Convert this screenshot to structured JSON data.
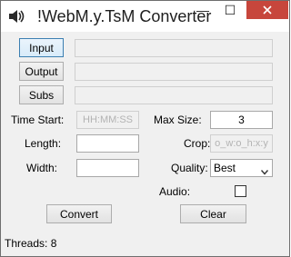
{
  "window": {
    "title": "!WebM.y.TsM Converter",
    "minimize_glyph": "—",
    "maximize_glyph": "☐",
    "close_color": "#c7463c"
  },
  "inputs": {
    "input_label": "Input",
    "output_label": "Output",
    "subs_label": "Subs",
    "input_value": "",
    "output_value": "",
    "subs_value": ""
  },
  "options": {
    "time_start_label": "Time Start:",
    "time_start_placeholder": "HH:MM:SS",
    "length_label": "Length:",
    "length_value": "",
    "width_label": "Width:",
    "width_value": "",
    "max_size_label": "Max Size:",
    "max_size_value": "3",
    "crop_label": "Crop:",
    "crop_placeholder": "o_w:o_h:x:y",
    "quality_label": "Quality:",
    "quality_value": "Best",
    "audio_label": "Audio:",
    "audio_checked": false
  },
  "actions": {
    "convert_label": "Convert",
    "clear_label": "Clear"
  },
  "status": {
    "threads_text": "Threads: 8"
  }
}
